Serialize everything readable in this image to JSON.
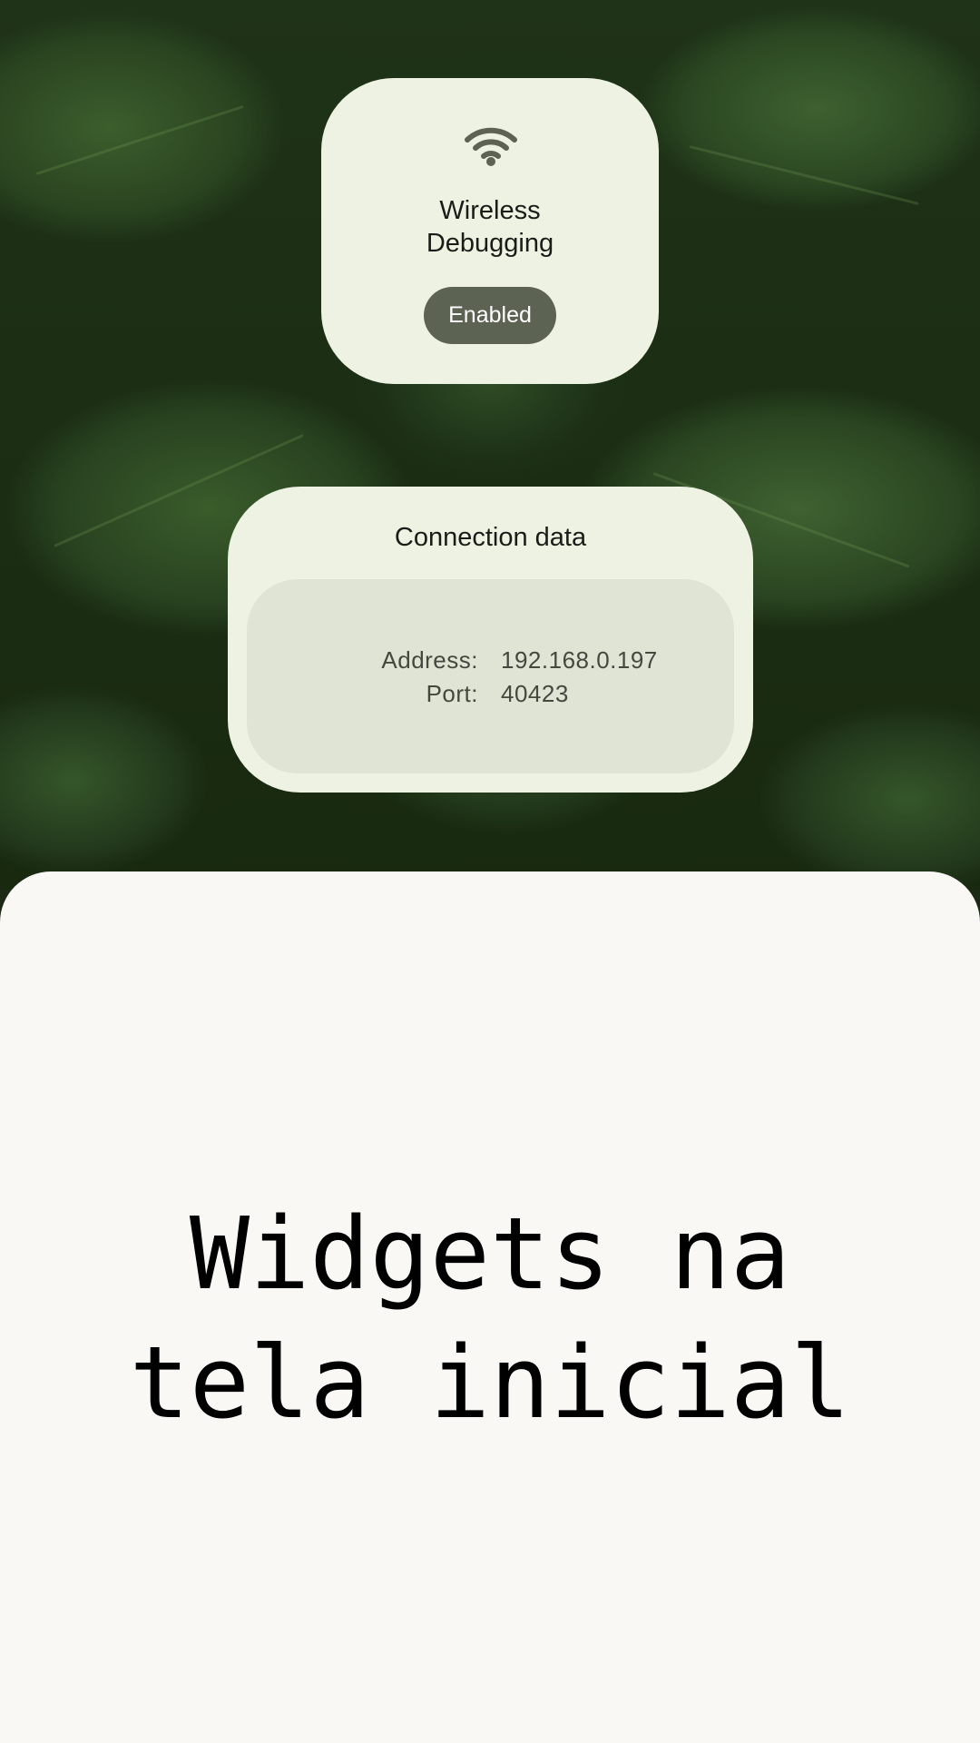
{
  "wireless_debugging_tile": {
    "icon": "wifi-icon",
    "title_line1": "Wireless",
    "title_line2": "Debugging",
    "status": "Enabled",
    "icon_color": "#5d6353",
    "status_background": "#5d6353"
  },
  "connection_data": {
    "title": "Connection data",
    "rows": [
      {
        "label": "Address:",
        "value": "192.168.0.197"
      },
      {
        "label": "Port:",
        "value": "40423"
      }
    ]
  },
  "caption": {
    "line1": "Widgets na",
    "line2": "tela inicial"
  },
  "colors": {
    "widget_background": "#eef2e3",
    "inner_panel": "#e0e4d5",
    "caption_panel": "#f9f8f5"
  }
}
